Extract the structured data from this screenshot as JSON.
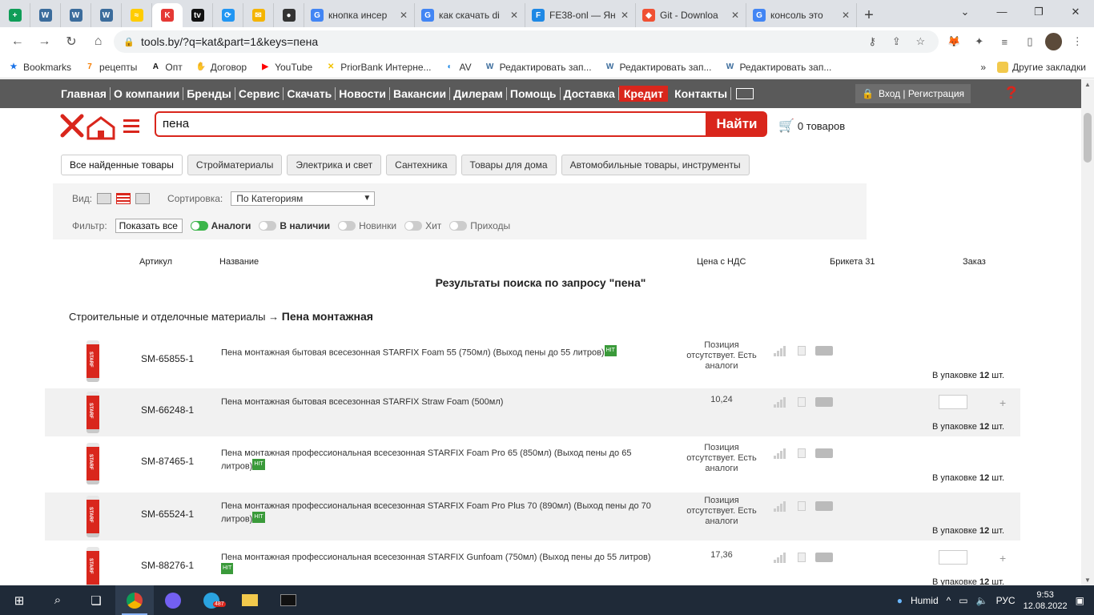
{
  "browser": {
    "tabs": [
      {
        "type": "icon",
        "icon": "sheets-icon",
        "color": "#0f9d58",
        "glyph": "+"
      },
      {
        "type": "icon",
        "icon": "wordpress-icon",
        "color": "#3b6c9c",
        "glyph": "W"
      },
      {
        "type": "icon",
        "icon": "wordpress-icon",
        "color": "#3b6c9c",
        "glyph": "W"
      },
      {
        "type": "icon",
        "icon": "wordpress-icon",
        "color": "#3b6c9c",
        "glyph": "W"
      },
      {
        "type": "icon",
        "icon": "yellow-logo-icon",
        "color": "#ffcc00",
        "glyph": "≈"
      },
      {
        "type": "icon",
        "icon": "k-logo-icon",
        "color": "#e53935",
        "glyph": "K",
        "active": true
      },
      {
        "type": "icon",
        "icon": "tv-logo-icon",
        "color": "#111111",
        "glyph": "tv"
      },
      {
        "type": "icon",
        "icon": "bird-logo-icon",
        "color": "#2196f3",
        "glyph": "⟳"
      },
      {
        "type": "icon",
        "icon": "mail-icon",
        "color": "#f4b400",
        "glyph": "✉"
      },
      {
        "type": "icon",
        "icon": "github-icon",
        "color": "#333333",
        "glyph": "●"
      },
      {
        "type": "wide",
        "icon": "google-icon",
        "color": "#4285f4",
        "glyph": "G",
        "title": "кнопка инсер"
      },
      {
        "type": "wide",
        "icon": "google-icon",
        "color": "#4285f4",
        "glyph": "G",
        "title": "как скачать di"
      },
      {
        "type": "wide",
        "icon": "yandex-icon",
        "color": "#1e88e5",
        "glyph": "F",
        "title": "FE38-onl — Ян"
      },
      {
        "type": "wide",
        "icon": "git-icon",
        "color": "#f05033",
        "glyph": "◆",
        "title": "Git - Downloa"
      },
      {
        "type": "wide",
        "icon": "google-icon",
        "color": "#4285f4",
        "glyph": "G",
        "title": "консоль это"
      }
    ],
    "url": "tools.by/?q=kat&part=1&keys=пена",
    "bookmarks": [
      {
        "label": "Bookmarks",
        "icon": "star-icon",
        "glyph": "★",
        "color": "#1a73e8"
      },
      {
        "label": "рецепты",
        "icon": "seven-icon",
        "glyph": "7",
        "color": "#f57c00"
      },
      {
        "label": "Опт",
        "icon": "a-letter-icon",
        "glyph": "A",
        "color": "#111111"
      },
      {
        "label": "Договор",
        "icon": "handshake-icon",
        "glyph": "✋",
        "color": "#777777"
      },
      {
        "label": "YouTube",
        "icon": "youtube-icon",
        "glyph": "▶",
        "color": "#ff0000"
      },
      {
        "label": "PriorBank Интерне...",
        "icon": "priorbank-icon",
        "glyph": "✕",
        "color": "#f2c200"
      },
      {
        "label": "AV",
        "icon": "av-icon",
        "glyph": "◐",
        "color": "#1e88e5"
      },
      {
        "label": "Редактировать зап...",
        "icon": "wordpress-icon",
        "glyph": "W",
        "color": "#3b6c9c"
      },
      {
        "label": "Редактировать зап...",
        "icon": "wordpress-icon",
        "glyph": "W",
        "color": "#3b6c9c"
      },
      {
        "label": "Редактировать зап...",
        "icon": "wordpress-icon",
        "glyph": "W",
        "color": "#3b6c9c"
      }
    ],
    "bookmarks_more": "»",
    "other_bookmarks": "Другие закладки"
  },
  "site": {
    "nav": [
      "Главная",
      "О компании",
      "Бренды",
      "Сервис",
      "Скачать",
      "Новости",
      "Вакансии",
      "Дилерам",
      "Помощь",
      "Доставка"
    ],
    "nav_credit": "Кредит",
    "nav_contacts": "Контакты",
    "login": "Вход | Регистрация",
    "help": "?",
    "search_value": "пена",
    "search_button": "Найти",
    "cart": "0 товаров",
    "categories": [
      {
        "label": "Все найденные товары",
        "active": true
      },
      {
        "label": "Стройматериалы"
      },
      {
        "label": "Электрика и свет"
      },
      {
        "label": "Сантехника"
      },
      {
        "label": "Товары для дома"
      },
      {
        "label": "Автомобильные товары, инструменты"
      }
    ],
    "view_label": "Вид:",
    "sort_label": "Сортировка:",
    "sort_value": "По Категориям",
    "filter_label": "Фильтр:",
    "filter_value": "Показать все",
    "toggles": [
      {
        "label": "Аналоги",
        "on": true,
        "bold": true
      },
      {
        "label": "В наличии",
        "on": false,
        "bold": true
      },
      {
        "label": "Новинки",
        "on": false,
        "bold": false
      },
      {
        "label": "Хит",
        "on": false,
        "bold": false
      },
      {
        "label": "Приходы",
        "on": false,
        "bold": false
      }
    ],
    "table_headers": {
      "article": "Артикул",
      "name": "Название",
      "price": "Цена с НДС",
      "stock": "Брикета 31",
      "order": "Заказ"
    },
    "results_title": "Результаты поиска по запросу \"пена\"",
    "crumb_parent": "Строительные и отделочные материалы",
    "crumb_arrow": "→",
    "crumb_current": "Пена монтажная",
    "products": [
      {
        "article": "SM-65855-1",
        "name": "Пена монтажная бытовая всесезонная STARFIX Foam 55 (750мл) (Выход пены до 55 литров)",
        "hit": true,
        "price": "Позиция отсутствует. Есть аналоги",
        "pack_prefix": "В упаковке",
        "pack_qty": "12",
        "pack_unit": "шт.",
        "has_qty": false
      },
      {
        "article": "SM-66248-1",
        "name": "Пена монтажная бытовая всесезонная STARFIX Straw Foam (500мл)",
        "hit": false,
        "price": "10,24",
        "pack_prefix": "В упаковке",
        "pack_qty": "12",
        "pack_unit": "шт.",
        "has_qty": true
      },
      {
        "article": "SM-87465-1",
        "name": "Пена монтажная профессиональная всесезонная STARFIX Foam Pro 65 (850мл) (Выход пены до 65 литров)",
        "hit": true,
        "price": "Позиция отсутствует. Есть аналоги",
        "pack_prefix": "В упаковке",
        "pack_qty": "12",
        "pack_unit": "шт.",
        "has_qty": false
      },
      {
        "article": "SM-65524-1",
        "name": "Пена монтажная профессиональная всесезонная STARFIX Foam Pro Plus 70 (890мл) (Выход пены до 70 литров)",
        "hit": true,
        "price": "Позиция отсутствует. Есть аналоги",
        "pack_prefix": "В упаковке",
        "pack_qty": "12",
        "pack_unit": "шт.",
        "has_qty": false
      },
      {
        "article": "SM-88276-1",
        "name": "Пена монтажная профессиональная всесезонная STARFIX Gunfoam (750мл) (Выход пены до 55 литров)",
        "hit": true,
        "price": "17,36",
        "pack_prefix": "В упаковке",
        "pack_qty": "12",
        "pack_unit": "шт.",
        "has_qty": true
      }
    ],
    "hit_badge": "HIT"
  },
  "taskbar": {
    "weather": "Humid",
    "lang": "РУС",
    "time": "9:53",
    "date": "12.08.2022",
    "telegram_badge": "487"
  },
  "colors": {
    "brand_red": "#d9261c",
    "nav_bg": "#5a5a5a",
    "taskbar_bg": "#1f2a38"
  }
}
